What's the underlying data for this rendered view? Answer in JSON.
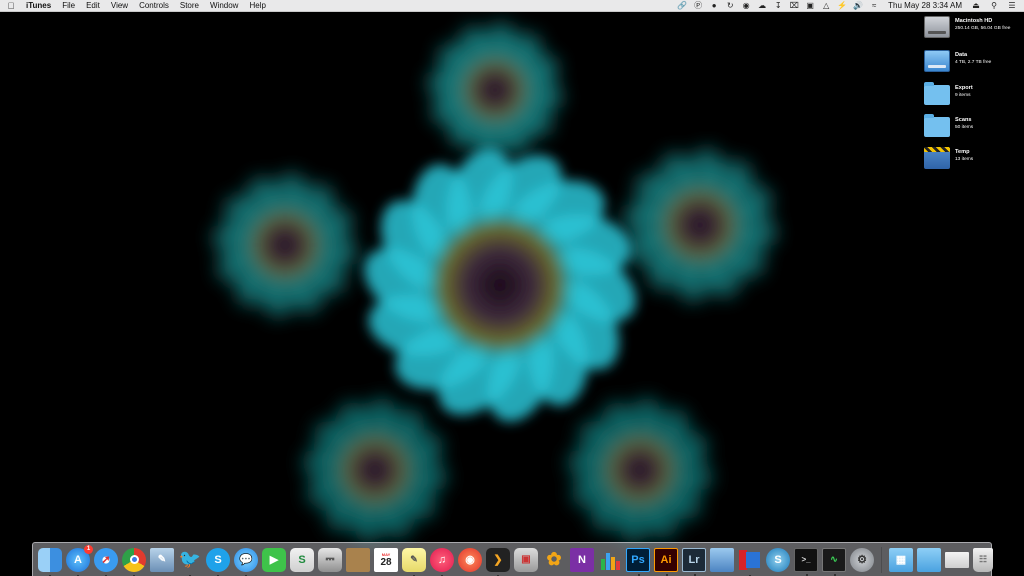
{
  "menubar": {
    "apple_icon": "apple-icon",
    "app_name": "iTunes",
    "menus": [
      "File",
      "Edit",
      "View",
      "Controls",
      "Store",
      "Window",
      "Help"
    ],
    "status_icons": [
      "link-icon",
      "skype-status-icon",
      "tag-icon",
      "sync-icon",
      "eye-icon",
      "cloud-icon",
      "download-icon",
      "x-box-icon",
      "screen-icon",
      "airplay-icon",
      "bolt-icon",
      "volume-icon",
      "wifi-icon"
    ],
    "clock": "Thu May 28  3:34 AM",
    "eject_icon": "eject-icon",
    "search_icon": "spotlight-icon",
    "list_icon": "notification-list-icon"
  },
  "desktop": {
    "items": [
      {
        "name": "Macintosh HD",
        "sub": "250.14 GB, 56.04 GB free",
        "icon": "hard-drive-icon"
      },
      {
        "name": "Data",
        "sub": "4 TB, 2.7 TB free",
        "icon": "external-drive-icon"
      },
      {
        "name": "Export",
        "sub": "9 items",
        "icon": "folder-icon"
      },
      {
        "name": "Scans",
        "sub": "50 items",
        "icon": "folder-icon"
      },
      {
        "name": "Temp",
        "sub": "13 items",
        "icon": "striped-folder-icon"
      }
    ]
  },
  "dock": {
    "app_store_badge": "1",
    "calendar_month": "MAY",
    "calendar_day": "28",
    "photoshop_label": "Ps",
    "illustrator_label": "Ai",
    "lightroom_label": "Lr",
    "notes_label": "N",
    "apps": [
      "finder-icon",
      "app-store-icon",
      "safari-icon",
      "chrome-icon",
      "preview-icon",
      "bird-icon",
      "skype-icon",
      "messages-icon",
      "facetime-icon",
      "scrivener-icon",
      "scanner-icon",
      "notebook-icon",
      "calendar-icon",
      "stickies-icon",
      "itunes-icon",
      "podcasts-icon",
      "plex-icon",
      "screenshot-icon",
      "tes-butterfly-icon",
      "onenote-icon",
      "numbers-icon",
      "photoshop-icon",
      "illustrator-icon",
      "lightroom-icon",
      "system-monitor-icon",
      "parallels-icon",
      "sync-s-icon",
      "terminal-icon",
      "activity-monitor-icon",
      "system-preferences-icon"
    ],
    "folders": [
      "applications-folder-icon",
      "documents-folder-icon",
      "downloads-stack-icon"
    ],
    "trash": "trash-icon"
  }
}
